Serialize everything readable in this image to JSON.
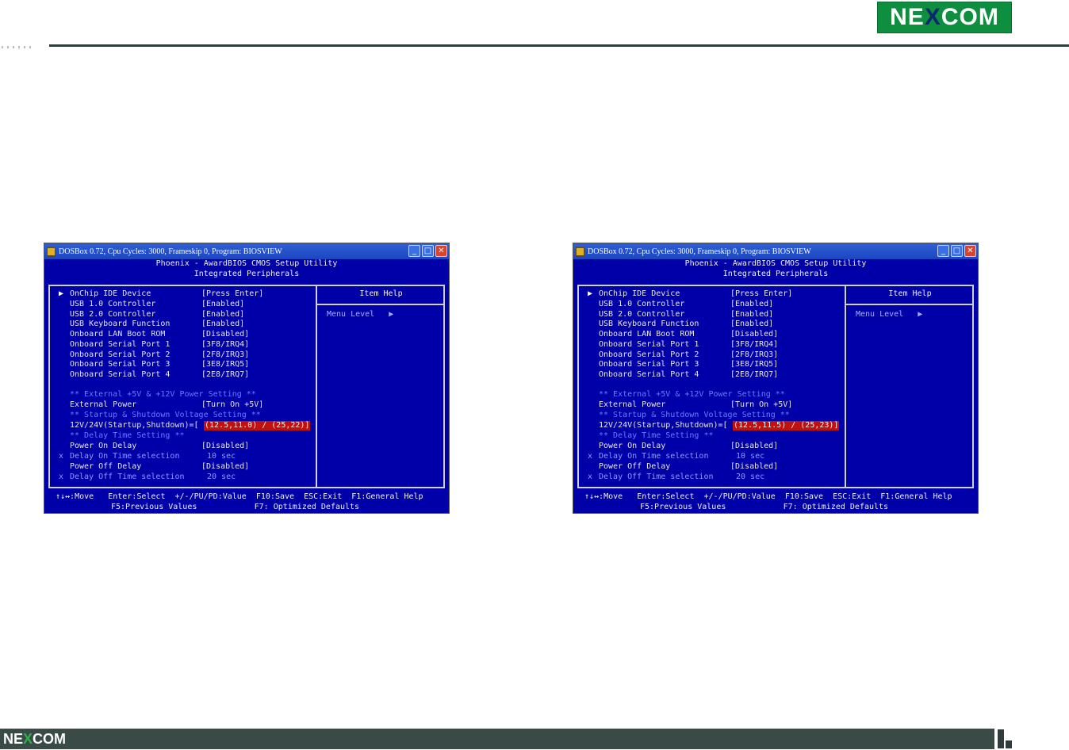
{
  "header": {
    "logo": {
      "pre": "NE",
      "mid": "X",
      "post": "COM"
    }
  },
  "footer": {
    "logo": {
      "pre": "NE",
      "mid": "X",
      "post": "COM"
    }
  },
  "windows": [
    {
      "title": "DOSBox 0.72, Cpu Cycles:     3000, Frameskip  0, Program:  BIOSVIEW",
      "header1": "Phoenix - AwardBIOS CMOS Setup Utility",
      "header2": "Integrated Peripherals",
      "item_help": "Item Help",
      "menu_level": "Menu Level   ▶",
      "rows": [
        {
          "label": "OnChip IDE Device",
          "value": "[Press Enter]"
        },
        {
          "label": "USB 1.0 Controller",
          "value": "[Enabled]"
        },
        {
          "label": "USB 2.0 Controller",
          "value": "[Enabled]"
        },
        {
          "label": "USB Keyboard Function",
          "value": "[Enabled]"
        },
        {
          "label": "Onboard LAN Boot ROM",
          "value": "[Disabled]"
        },
        {
          "label": "Onboard Serial Port 1",
          "value": "[3F8/IRQ4]"
        },
        {
          "label": "Onboard Serial Port 2",
          "value": "[2F8/IRQ3]"
        },
        {
          "label": "Onboard Serial Port 3",
          "value": "[3E8/IRQ5]"
        },
        {
          "label": "Onboard Serial Port 4",
          "value": "[2E8/IRQ7]"
        }
      ],
      "section_power": "** External +5V & +12V Power Setting **",
      "external_power_label": "External Power",
      "external_power_value": "[Turn On +5V]",
      "section_voltage": "** Startup & Shutdown Voltage Setting **",
      "voltage_label": "12V/24V(Startup,Shutdown)=",
      "voltage_prefix": "[",
      "voltage_value": "(12.5,11.0) / (25,22)]",
      "section_delay": "** Delay Time Setting **",
      "power_on_label": "Power On Delay",
      "power_on_value": "[Disabled]",
      "delay_on_label": "Delay On Time selection",
      "delay_on_value": "10 sec",
      "power_off_label": "Power Off Delay",
      "power_off_value": "[Disabled]",
      "delay_off_label": "Delay Off Time selection",
      "delay_off_value": "20 sec",
      "foot1": "↑↓↔:Move   Enter:Select  +/-/PU/PD:Value  F10:Save  ESC:Exit  F1:General Help",
      "foot2": "F5:Previous Values            F7: Optimized Defaults"
    },
    {
      "title": "DOSBox 0.72, Cpu Cycles:     3000, Frameskip  0, Program:  BIOSVIEW",
      "header1": "Phoenix - AwardBIOS CMOS Setup Utility",
      "header2": "Integrated Peripherals",
      "item_help": "Item Help",
      "menu_level": "Menu Level   ▶",
      "rows": [
        {
          "label": "OnChip IDE Device",
          "value": "[Press Enter]"
        },
        {
          "label": "USB 1.0 Controller",
          "value": "[Enabled]"
        },
        {
          "label": "USB 2.0 Controller",
          "value": "[Enabled]"
        },
        {
          "label": "USB Keyboard Function",
          "value": "[Enabled]"
        },
        {
          "label": "Onboard LAN Boot ROM",
          "value": "[Disabled]"
        },
        {
          "label": "Onboard Serial Port 1",
          "value": "[3F8/IRQ4]"
        },
        {
          "label": "Onboard Serial Port 2",
          "value": "[2F8/IRQ3]"
        },
        {
          "label": "Onboard Serial Port 3",
          "value": "[3E8/IRQ5]"
        },
        {
          "label": "Onboard Serial Port 4",
          "value": "[2E8/IRQ7]"
        }
      ],
      "section_power": "** External +5V & +12V Power Setting **",
      "external_power_label": "External Power",
      "external_power_value": "[Turn On +5V]",
      "section_voltage": "** Startup & Shutdown Voltage Setting **",
      "voltage_label": "12V/24V(Startup,Shutdown)=",
      "voltage_prefix": "[",
      "voltage_value": "(12.5,11.5) / (25,23)]",
      "section_delay": "** Delay Time Setting **",
      "power_on_label": "Power On Delay",
      "power_on_value": "[Disabled]",
      "delay_on_label": "Delay On Time selection",
      "delay_on_value": "10 sec",
      "power_off_label": "Power Off Delay",
      "power_off_value": "[Disabled]",
      "delay_off_label": "Delay Off Time selection",
      "delay_off_value": "20 sec",
      "foot1": "↑↓↔:Move   Enter:Select  +/-/PU/PD:Value  F10:Save  ESC:Exit  F1:General Help",
      "foot2": "F5:Previous Values            F7: Optimized Defaults"
    }
  ],
  "icons": {
    "minimize": "_",
    "maximize": "□",
    "close": "✕",
    "pointer": "▶",
    "xmark": "x"
  }
}
